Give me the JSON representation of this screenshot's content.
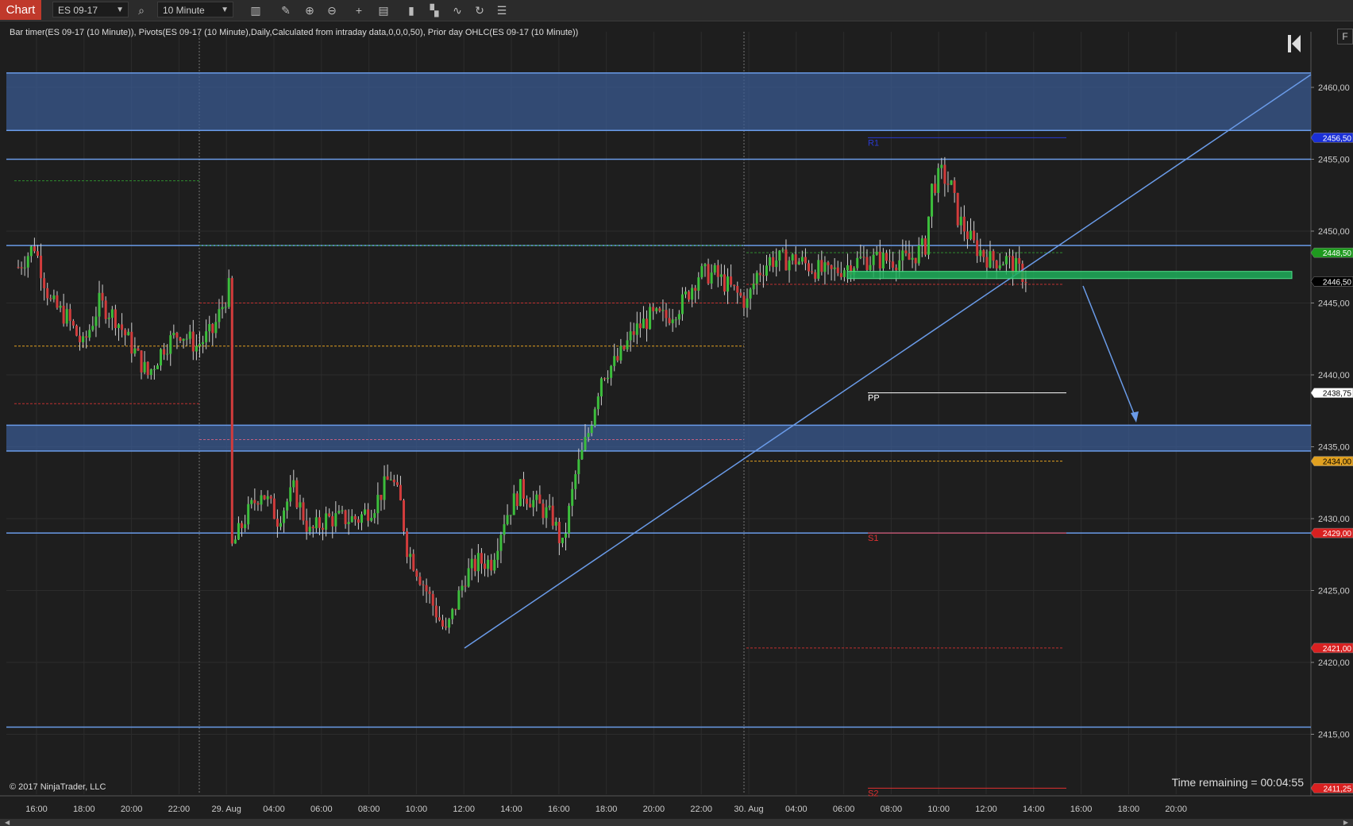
{
  "toolbar": {
    "chart_tab": "Chart",
    "instrument": "ES 09-17",
    "timeframe": "10 Minute",
    "icons": [
      "search-icon",
      "bar-type-icon",
      "draw-pencil-icon",
      "zoom-in-icon",
      "zoom-out-icon",
      "crosshair-icon",
      "data-box-icon",
      "chart-trader-icon",
      "strategies-icon",
      "indicators-icon",
      "refresh-icon",
      "properties-icon"
    ]
  },
  "chart": {
    "indicator_label": "Bar timer(ES 09-17 (10 Minute)), Pivots(ES 09-17 (10 Minute),Daily,Calculated from intraday data,0,0,0,50), Prior day OHLC(ES 09-17 (10 Minute))",
    "copyright": "© 2017 NinjaTrader, LLC",
    "time_remaining": "Time remaining = 00:04:55",
    "f_button": "F",
    "colors": {
      "background": "#1e1e1e",
      "zone_fill": "#3a5a90",
      "zone_line": "#6a9be8",
      "up_candle": "#3cbe3c",
      "down_candle": "#d23c3c",
      "pivot_r1": "#2a3ad0",
      "pivot_pp": "#ffffff",
      "pivot_s": "#e03030",
      "prior_high": "#2e8b2e",
      "prior_low": "#c03030",
      "prior_close": "#e0a020"
    },
    "pivot_labels": {
      "r1": "R1",
      "pp": "PP",
      "s1": "S1",
      "s2": "S2"
    }
  },
  "chart_data": {
    "type": "candlestick",
    "instrument": "ES 09-17",
    "interval": "10 Minute",
    "x_ticks": [
      "16:00",
      "18:00",
      "20:00",
      "22:00",
      "29. Aug",
      "04:00",
      "06:00",
      "08:00",
      "10:00",
      "12:00",
      "14:00",
      "16:00",
      "18:00",
      "20:00",
      "22:00",
      "30. Aug",
      "04:00",
      "06:00",
      "08:00",
      "10:00",
      "12:00",
      "14:00",
      "16:00",
      "18:00",
      "20:00"
    ],
    "y_ticks": [
      "2460,00",
      "2455,00",
      "2450,00",
      "2445,00",
      "2440,00",
      "2435,00",
      "2430,00",
      "2425,00",
      "2420,00",
      "2415,00"
    ],
    "ylim": [
      2410.5,
      2462.3
    ],
    "price_badges": [
      {
        "label": "2456,50",
        "value": 2456.5,
        "color": "#1a2fd6",
        "text_color": "#ffffff"
      },
      {
        "label": "2448,50",
        "value": 2448.5,
        "color": "#1f9a1f",
        "text_color": "#ffffff"
      },
      {
        "label": "2446,50",
        "value": 2446.5,
        "color": "#000000",
        "text_color": "#ffffff"
      },
      {
        "label": "2438,75",
        "value": 2438.75,
        "color": "#ffffff",
        "text_color": "#000000"
      },
      {
        "label": "2434,00",
        "value": 2434.0,
        "color": "#e0a020",
        "text_color": "#000000"
      },
      {
        "label": "2429,00",
        "value": 2429.0,
        "color": "#d92020",
        "text_color": "#ffffff"
      },
      {
        "label": "2421,00",
        "value": 2421.0,
        "color": "#d92020",
        "text_color": "#ffffff"
      },
      {
        "label": "2411,25",
        "value": 2411.25,
        "color": "#d92020",
        "text_color": "#ffffff"
      }
    ],
    "price_path": [
      [
        0,
        2447.5
      ],
      [
        5,
        2449
      ],
      [
        10,
        2445
      ],
      [
        15,
        2444
      ],
      [
        20,
        2442
      ],
      [
        25,
        2445
      ],
      [
        30,
        2444
      ],
      [
        35,
        2442
      ],
      [
        40,
        2440
      ],
      [
        45,
        2442
      ],
      [
        50,
        2443
      ],
      [
        55,
        2442
      ],
      [
        60,
        2443
      ],
      [
        65,
        2446
      ],
      [
        66,
        2428
      ],
      [
        70,
        2430
      ],
      [
        75,
        2432
      ],
      [
        80,
        2430
      ],
      [
        85,
        2432
      ],
      [
        90,
        2429
      ],
      [
        95,
        2430
      ],
      [
        100,
        2430
      ],
      [
        105,
        2430
      ],
      [
        110,
        2431
      ],
      [
        115,
        2433
      ],
      [
        118,
        2431
      ],
      [
        120,
        2428
      ],
      [
        124,
        2426
      ],
      [
        128,
        2424
      ],
      [
        132,
        2422
      ],
      [
        135,
        2424
      ],
      [
        138,
        2426
      ],
      [
        142,
        2427
      ],
      [
        146,
        2427
      ],
      [
        150,
        2430
      ],
      [
        155,
        2432
      ],
      [
        160,
        2431
      ],
      [
        165,
        2430
      ],
      [
        168,
        2428
      ],
      [
        172,
        2433
      ],
      [
        176,
        2436
      ],
      [
        180,
        2440
      ],
      [
        185,
        2441
      ],
      [
        190,
        2443
      ],
      [
        195,
        2444
      ],
      [
        200,
        2444
      ],
      [
        205,
        2445
      ],
      [
        210,
        2447
      ],
      [
        215,
        2447
      ],
      [
        220,
        2446
      ],
      [
        225,
        2445
      ],
      [
        228,
        2447
      ],
      [
        232,
        2448
      ],
      [
        240,
        2448
      ],
      [
        250,
        2447
      ],
      [
        260,
        2448
      ],
      [
        270,
        2448
      ],
      [
        275,
        2448
      ],
      [
        280,
        2449
      ],
      [
        282,
        2453
      ],
      [
        285,
        2454
      ],
      [
        288,
        2453
      ],
      [
        290,
        2451
      ],
      [
        295,
        2449
      ],
      [
        300,
        2448
      ],
      [
        305,
        2448
      ],
      [
        310,
        2447
      ],
      [
        312,
        2446.5
      ]
    ],
    "pivots": {
      "r1": 2456.5,
      "pp": 2438.75,
      "s1": 2429.0,
      "s2": 2411.25
    },
    "prior_day_ohlc": {
      "day1": {
        "high": 2453.5,
        "close": 2442.0,
        "low": 2438.0
      },
      "day2": {
        "high": 2449.0,
        "close": 2442.0,
        "low": 2446.5
      },
      "day3": {
        "high": 2448.5,
        "close": 2434.0,
        "low": 2421.0
      }
    },
    "zones": [
      {
        "top": 2461.0,
        "bottom": 2457.0
      },
      {
        "top": 2436.5,
        "bottom": 2434.7
      }
    ],
    "horizontal_lines": [
      2455.0,
      2449.0,
      2429.0,
      2415.5
    ],
    "trendline": {
      "start": [
        2010,
        2422
      ],
      "end": [
        2060,
        2461
      ]
    },
    "target_zone": {
      "top": 2447.2,
      "bottom": 2446.7
    }
  }
}
